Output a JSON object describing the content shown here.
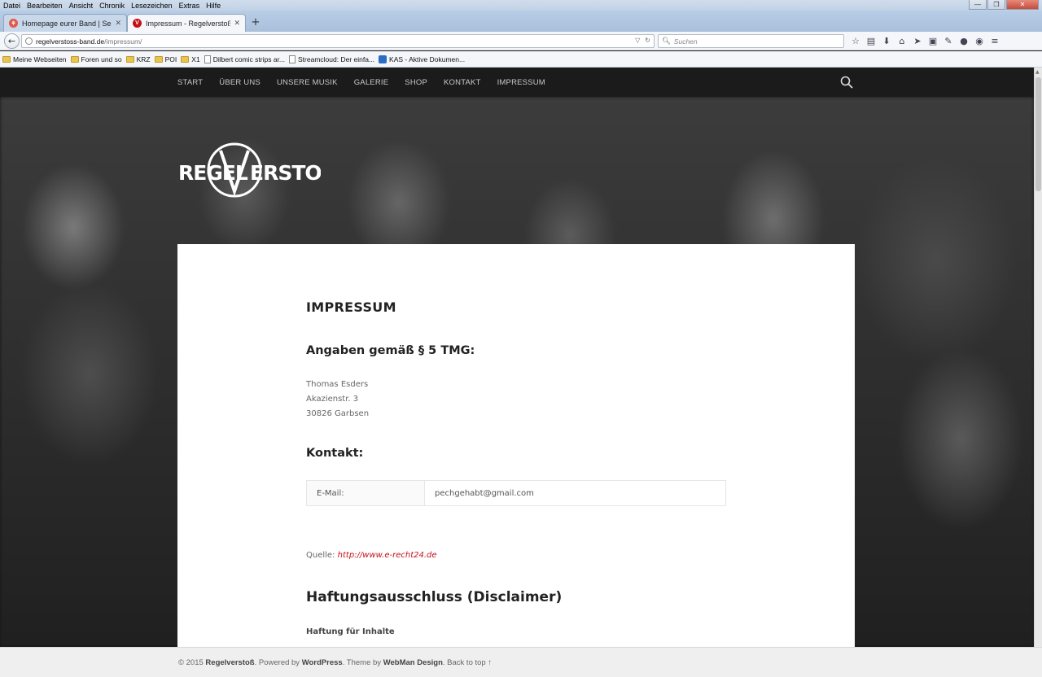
{
  "menubar": {
    "items": [
      "Datei",
      "Bearbeiten",
      "Ansicht",
      "Chronik",
      "Lesezeichen",
      "Extras",
      "Hilfe"
    ]
  },
  "tabs": [
    {
      "label": "Homepage eurer Band | Sei...",
      "active": false
    },
    {
      "label": "Impressum - Regelverstoß",
      "active": true
    }
  ],
  "navbar": {
    "url_host": "regelverstoss-band.de",
    "url_path": "/impressum/",
    "search_placeholder": "Suchen"
  },
  "bookmarks": [
    {
      "label": "Meine Webseiten",
      "icon": "folder-icon"
    },
    {
      "label": "Foren und so",
      "icon": "folder-icon"
    },
    {
      "label": "KRZ",
      "icon": "folder-icon"
    },
    {
      "label": "POI",
      "icon": "folder-icon"
    },
    {
      "label": "X1",
      "icon": "folder-icon"
    },
    {
      "label": "Dilbert comic strips ar...",
      "icon": "page-icon"
    },
    {
      "label": "Streamcloud: Der einfa...",
      "icon": "page-icon"
    },
    {
      "label": "KAS - Aktive Dokumen...",
      "icon": "blue-icon"
    }
  ],
  "site": {
    "nav": [
      "START",
      "ÜBER UNS",
      "UNSERE MUSIK",
      "GALERIE",
      "SHOP",
      "KONTAKT",
      "IMPRESSUM"
    ],
    "logo_text_left": "REGEL",
    "logo_text_right": "ERSTOß",
    "page_title": "IMPRESSUM",
    "section_angaben": "Angaben gemäß § 5 TMG:",
    "address": [
      "Thomas Esders",
      "Akazienstr. 3",
      "30826 Garbsen"
    ],
    "section_kontakt": "Kontakt:",
    "contact": {
      "label": "E-Mail:",
      "value": "pechgehabt@gmail.com"
    },
    "quelle_label": "Quelle:",
    "quelle_link": "http://www.e-recht24.de",
    "section_haftung": "Haftungsausschluss (Disclaimer)",
    "sub_inhalte": "Haftung für Inhalte"
  },
  "footer": {
    "prefix": "© 2015 ",
    "brand": "Regelverstoß",
    "powered": ". Powered by ",
    "wp": "WordPress",
    "theme": ". Theme by ",
    "webman": "WebMan Design",
    "back": ". Back to top ↑"
  },
  "colors": {
    "accent_link": "#c40f16",
    "nav_bg": "#1b1b1b"
  }
}
